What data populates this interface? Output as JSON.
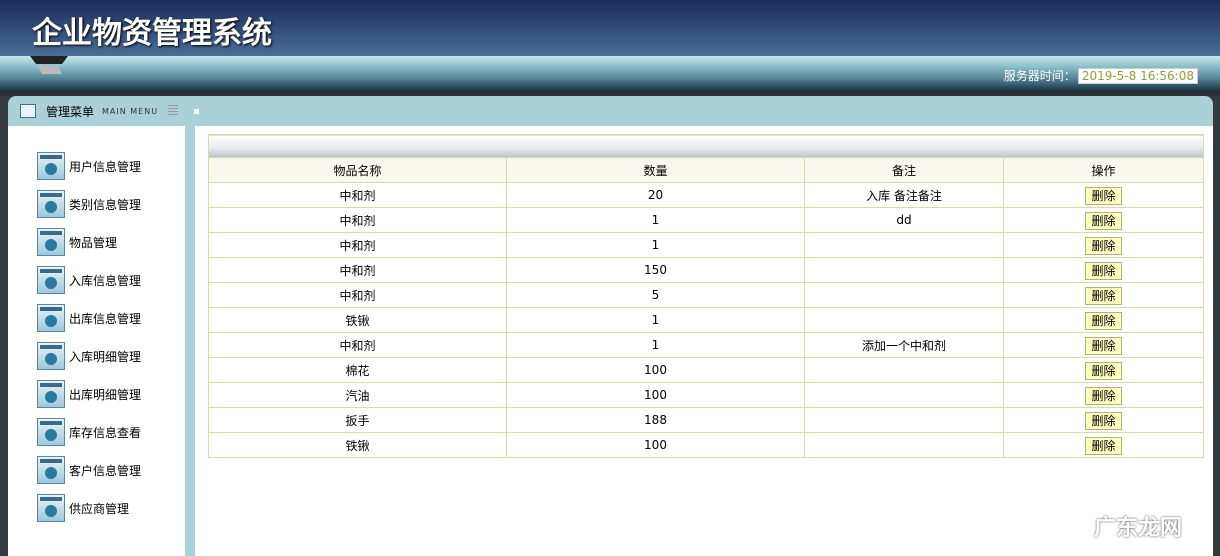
{
  "header": {
    "title": "企业物资管理系统",
    "server_time_label": "服务器时间：",
    "server_time": "2019-5-8 16:56:08"
  },
  "menu": {
    "title": "管理菜单",
    "subtitle": "MAIN MENU"
  },
  "sidebar": {
    "items": [
      {
        "label": "用户信息管理"
      },
      {
        "label": "类别信息管理"
      },
      {
        "label": "物品管理"
      },
      {
        "label": "入库信息管理"
      },
      {
        "label": "出库信息管理"
      },
      {
        "label": "入库明细管理"
      },
      {
        "label": "出库明细管理"
      },
      {
        "label": "库存信息查看"
      },
      {
        "label": "客户信息管理"
      },
      {
        "label": "供应商管理"
      }
    ]
  },
  "table": {
    "headers": [
      "物品名称",
      "数量",
      "备注",
      "操作"
    ],
    "rows": [
      {
        "name": "中和剂",
        "qty": "20",
        "note": "入库 备注备注",
        "action": "删除"
      },
      {
        "name": "中和剂",
        "qty": "1",
        "note": "dd",
        "action": "删除"
      },
      {
        "name": "中和剂",
        "qty": "1",
        "note": "",
        "action": "删除"
      },
      {
        "name": "中和剂",
        "qty": "150",
        "note": "",
        "action": "删除"
      },
      {
        "name": "中和剂",
        "qty": "5",
        "note": "",
        "action": "删除"
      },
      {
        "name": "铁锹",
        "qty": "1",
        "note": "",
        "action": "删除"
      },
      {
        "name": "中和剂",
        "qty": "1",
        "note": "添加一个中和剂",
        "action": "删除"
      },
      {
        "name": "棉花",
        "qty": "100",
        "note": "",
        "action": "删除"
      },
      {
        "name": "汽油",
        "qty": "100",
        "note": "",
        "action": "删除"
      },
      {
        "name": "扳手",
        "qty": "188",
        "note": "",
        "action": "删除"
      },
      {
        "name": "铁锹",
        "qty": "100",
        "note": "",
        "action": "删除"
      }
    ]
  },
  "watermark": "广东龙网"
}
